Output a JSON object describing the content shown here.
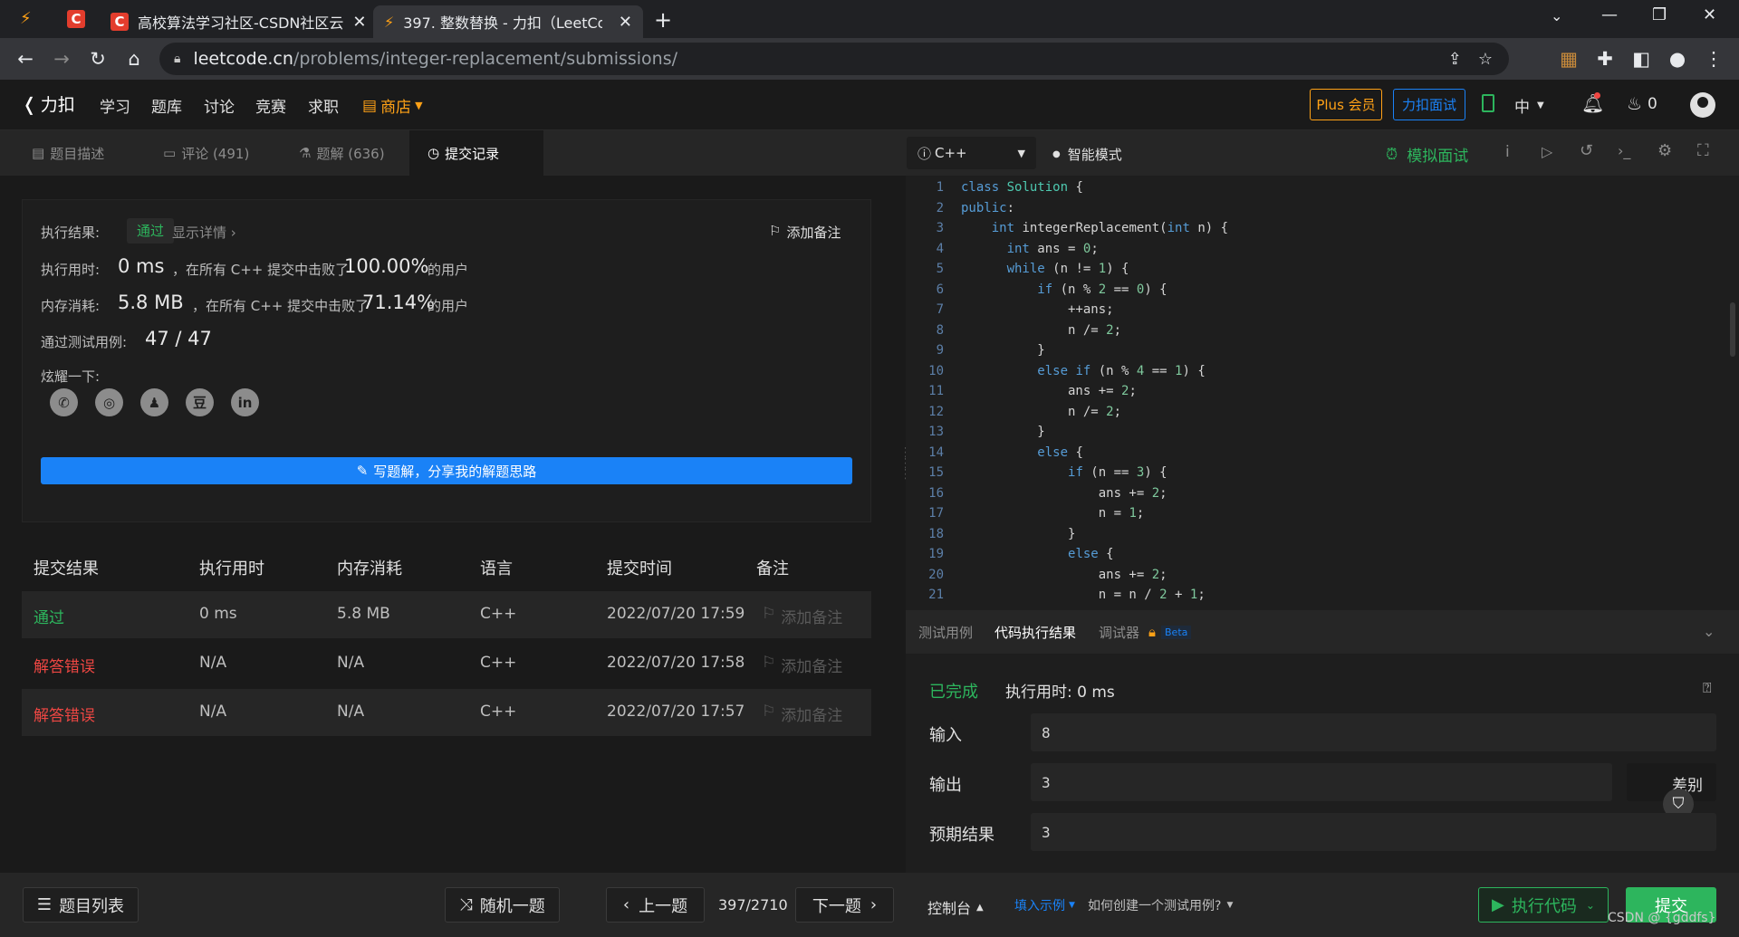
{
  "browser": {
    "tabs": [
      {
        "title": "高校算法学习社区-CSDN社区云",
        "active": false
      },
      {
        "title": "397. 整数替换 - 力扣（LeetCode）",
        "active": true
      }
    ],
    "url_host": "leetcode.cn",
    "url_path": "/problems/integer-replacement/submissions/"
  },
  "header": {
    "logo": "力扣",
    "nav": [
      "学习",
      "题库",
      "讨论",
      "竞赛",
      "求职"
    ],
    "store": "商店",
    "plus": "Plus 会员",
    "interview": "力扣面试",
    "lang": "中",
    "points": "0"
  },
  "left_tabs": [
    {
      "label": "题目描述",
      "icon": "document-icon"
    },
    {
      "label": "评论 (491)",
      "icon": "comment-icon"
    },
    {
      "label": "题解 (636)",
      "icon": "flask-icon"
    },
    {
      "label": "提交记录",
      "icon": "clock-icon",
      "active": true
    }
  ],
  "result": {
    "label_result": "执行结果:",
    "status": "通过",
    "details": "显示详情 ›",
    "add_note": "添加备注",
    "label_time": "执行用时:",
    "time_value": "0 ms",
    "time_text": "，在所有 C++ 提交中击败了",
    "time_pct": "100.00%",
    "users": "的用户",
    "label_mem": "内存消耗:",
    "mem_value": "5.8 MB",
    "mem_text": "，在所有 C++ 提交中击败了",
    "mem_pct": "71.14%",
    "label_cases": "通过测试用例:",
    "cases": "47 / 47",
    "label_share": "炫耀一下:",
    "share_icons": [
      "wechat-icon",
      "weibo-icon",
      "qq-icon",
      "douban-icon",
      "linkedin-icon"
    ],
    "share_glyphs": [
      "✆",
      "◎",
      "♟",
      "豆",
      "in"
    ],
    "write_btn": "写题解，分享我的解题思路"
  },
  "table": {
    "headers": [
      "提交结果",
      "执行用时",
      "内存消耗",
      "语言",
      "提交时间",
      "备注"
    ],
    "rows": [
      {
        "status": "通过",
        "time": "0 ms",
        "mem": "5.8 MB",
        "lang": "C++",
        "date": "2022/07/20 17:59",
        "note": "添加备注",
        "color": "#2db55d"
      },
      {
        "status": "解答错误",
        "time": "N/A",
        "mem": "N/A",
        "lang": "C++",
        "date": "2022/07/20 17:58",
        "note": "添加备注",
        "color": "#ef4743"
      },
      {
        "status": "解答错误",
        "time": "N/A",
        "mem": "N/A",
        "lang": "C++",
        "date": "2022/07/20 17:57",
        "note": "添加备注",
        "color": "#ef4743"
      }
    ]
  },
  "editor": {
    "language": "C++",
    "mode": "智能模式",
    "mock": "模拟面试",
    "lines": [
      "class Solution {",
      "public:",
      "    int integerReplacement(int n) {",
      "      int ans = 0;",
      "      while (n != 1) {",
      "          if (n % 2 == 0) {",
      "              ++ans;",
      "              n /= 2;",
      "          }",
      "          else if (n % 4 == 1) {",
      "              ans += 2;",
      "              n /= 2;",
      "          }",
      "          else {",
      "              if (n == 3) {",
      "                  ans += 2;",
      "                  n = 1;",
      "              }",
      "              else {",
      "                  ans += 2;",
      "                  n = n / 2 + 1;"
    ]
  },
  "console": {
    "tabs": [
      "测试用例",
      "代码执行结果",
      "调试器"
    ],
    "beta": "Beta",
    "done": "已完成",
    "exec_time": "执行用时: 0 ms",
    "input_label": "输入",
    "input_value": "8",
    "output_label": "输出",
    "output_value": "3",
    "expected_label": "预期结果",
    "expected_value": "3",
    "diff": "差别"
  },
  "footer": {
    "problem_list": "题目列表",
    "random": "随机一题",
    "prev": "上一题",
    "progress": "397/2710",
    "next": "下一题",
    "console": "控制台",
    "fill_example": "填入示例",
    "how_create": "如何创建一个测试用例?",
    "run": "执行代码",
    "submit": "提交",
    "watermark": "CSDN @ {gddfs}"
  },
  "colors": {
    "accent_green": "#2db55d",
    "error_red": "#ef4743",
    "primary_blue": "#1a82f7",
    "store_orange": "#ffa116"
  }
}
